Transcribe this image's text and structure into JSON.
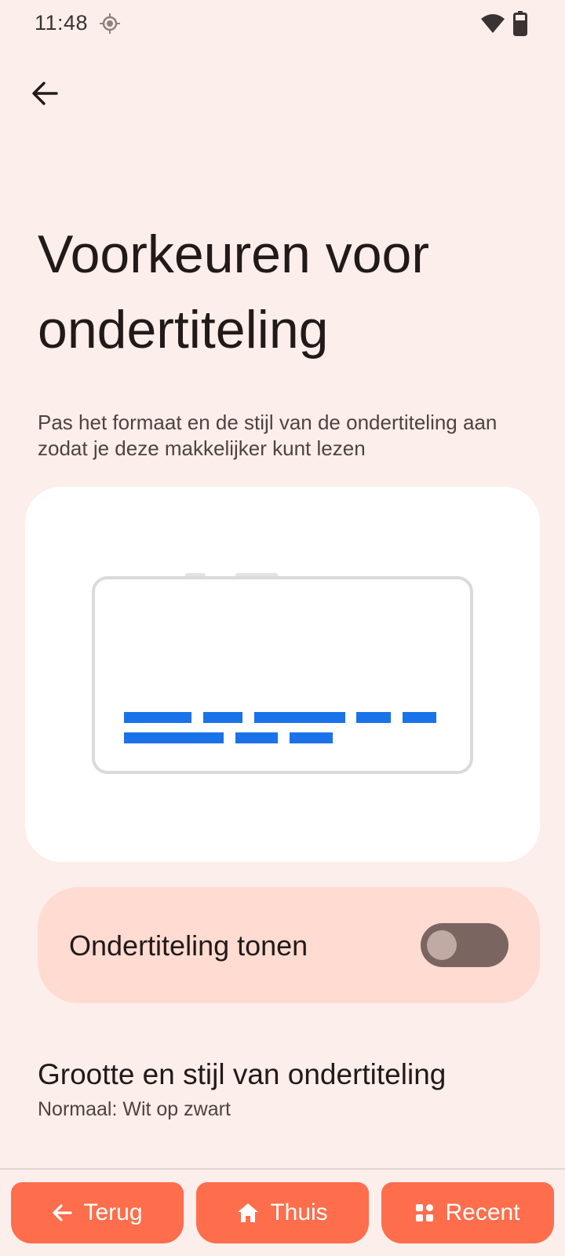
{
  "status_bar": {
    "time": "11:48"
  },
  "header": {
    "title": "Voorkeuren voor ondertiteling"
  },
  "description": "Pas het formaat en de stijl van de ondertiteling aan zodat je deze makkelijker kunt lezen",
  "toggle": {
    "label": "Ondertiteling tonen",
    "checked": false
  },
  "setting": {
    "title": "Grootte en stijl van ondertiteling",
    "subtitle": "Normaal: Wit op zwart"
  },
  "nav": {
    "back_label": "Terug",
    "home_label": "Thuis",
    "recent_label": "Recent"
  },
  "colors": {
    "background": "#fbeeeb",
    "accent": "#fe6e4c",
    "caption_lines": "#1a73e8",
    "toggle_row": "#ffdbd2"
  }
}
